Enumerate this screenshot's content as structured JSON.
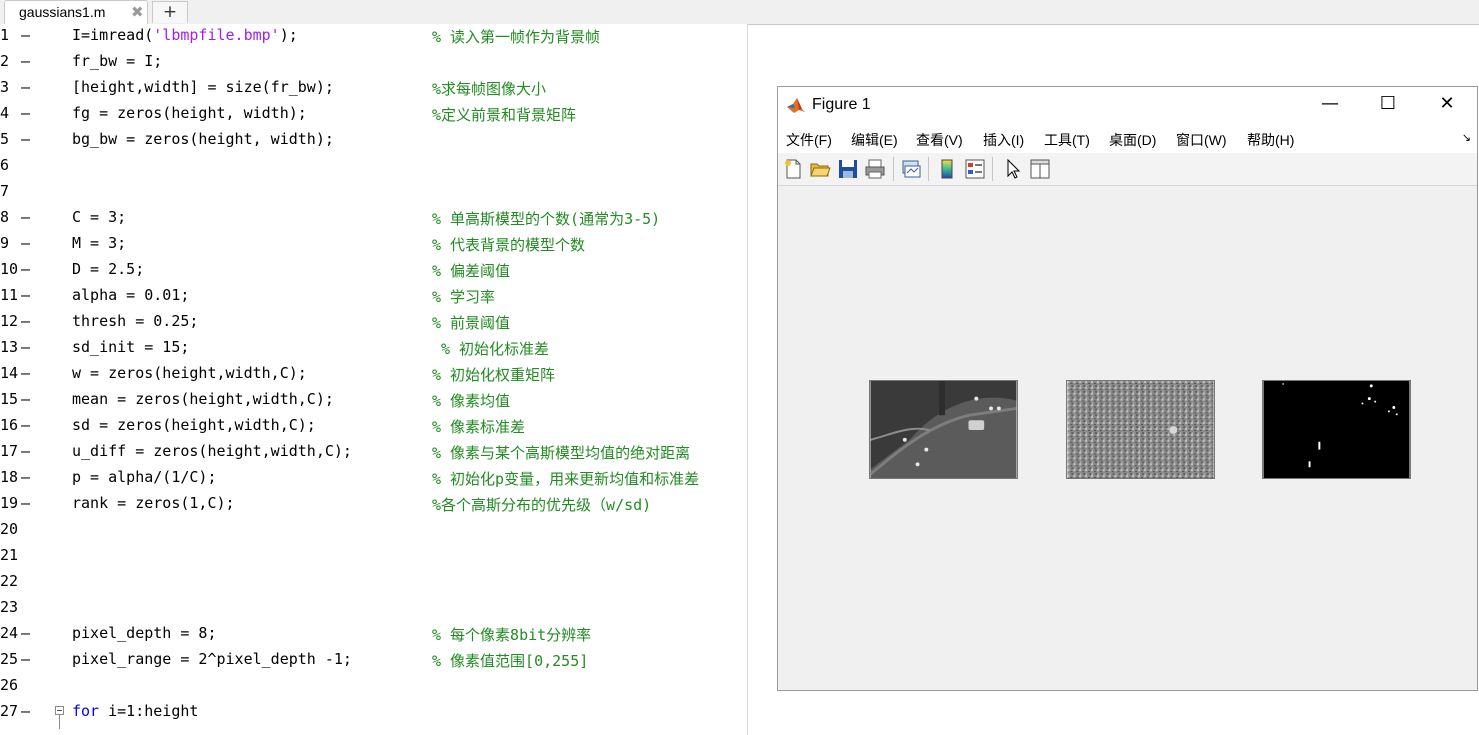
{
  "editor": {
    "tab_name": "gaussians1.m",
    "close_glyph": "✖",
    "new_tab_glyph": "+",
    "lines": [
      {
        "n": "1",
        "code": [
          {
            "t": "I=imread("
          },
          {
            "t": "'lbmpfile.bmp'",
            "c": "str"
          },
          {
            "t": ");"
          }
        ],
        "comment": "% 读入第一帧作为背景帧"
      },
      {
        "n": "2",
        "code": [
          {
            "t": "fr_bw = I;"
          }
        ],
        "comment": ""
      },
      {
        "n": "3",
        "code": [
          {
            "t": "[height,width] = size(fr_bw);"
          }
        ],
        "comment": "%求每帧图像大小"
      },
      {
        "n": "4",
        "code": [
          {
            "t": "fg = zeros(height, width);"
          }
        ],
        "comment": "%定义前景和背景矩阵"
      },
      {
        "n": "5",
        "code": [
          {
            "t": "bg_bw = zeros(height, width);"
          }
        ],
        "comment": ""
      },
      {
        "n": "6",
        "code": [],
        "comment": ""
      },
      {
        "n": "7",
        "code": [],
        "comment": ""
      },
      {
        "n": "8",
        "code": [
          {
            "t": "C = 3;"
          }
        ],
        "comment": "% 单高斯模型的个数(通常为3-5)"
      },
      {
        "n": "9",
        "code": [
          {
            "t": "M = 3;"
          }
        ],
        "comment": "% 代表背景的模型个数"
      },
      {
        "n": "10",
        "code": [
          {
            "t": "D = 2.5;"
          }
        ],
        "comment": "% 偏差阈值"
      },
      {
        "n": "11",
        "code": [
          {
            "t": "alpha = 0.01;"
          }
        ],
        "comment": "% 学习率"
      },
      {
        "n": "12",
        "code": [
          {
            "t": "thresh = 0.25;"
          }
        ],
        "comment": "% 前景阈值"
      },
      {
        "n": "13",
        "code": [
          {
            "t": "sd_init = 15;"
          }
        ],
        "comment": "% 初始化标准差",
        "shift": true
      },
      {
        "n": "14",
        "code": [
          {
            "t": "w = zeros(height,width,C);"
          }
        ],
        "comment": "% 初始化权重矩阵"
      },
      {
        "n": "15",
        "code": [
          {
            "t": "mean = zeros(height,width,C);"
          }
        ],
        "comment": "% 像素均值"
      },
      {
        "n": "16",
        "code": [
          {
            "t": "sd = zeros(height,width,C);"
          }
        ],
        "comment": "% 像素标准差"
      },
      {
        "n": "17",
        "code": [
          {
            "t": "u_diff = zeros(height,width,C);"
          }
        ],
        "comment": "% 像素与某个高斯模型均值的绝对距离"
      },
      {
        "n": "18",
        "code": [
          {
            "t": "p = alpha/(1/C);"
          }
        ],
        "comment": "% 初始化p变量，用来更新均值和标准差"
      },
      {
        "n": "19",
        "code": [
          {
            "t": "rank = zeros(1,C);"
          }
        ],
        "comment": "%各个高斯分布的优先级（w/sd)"
      },
      {
        "n": "20",
        "code": [],
        "comment": ""
      },
      {
        "n": "21",
        "code": [],
        "comment": ""
      },
      {
        "n": "22",
        "code": [],
        "comment": ""
      },
      {
        "n": "23",
        "code": [],
        "comment": ""
      },
      {
        "n": "24",
        "code": [
          {
            "t": "pixel_depth = 8;"
          }
        ],
        "comment": "% 每个像素8bit分辨率"
      },
      {
        "n": "25",
        "code": [
          {
            "t": "pixel_range = 2^pixel_depth -1;"
          }
        ],
        "comment": "% 像素值范围[0,255]"
      },
      {
        "n": "26",
        "code": [],
        "comment": ""
      },
      {
        "n": "27",
        "code": [
          {
            "t": "for",
            "c": "kw"
          },
          {
            "t": " i=1:height"
          }
        ],
        "comment": "",
        "fold": true
      }
    ]
  },
  "figure": {
    "title": "Figure 1",
    "controls": {
      "minimize": "—",
      "maximize": "☐",
      "close": "✕"
    },
    "menu": [
      "文件(F)",
      "编辑(E)",
      "查看(V)",
      "插入(I)",
      "工具(T)",
      "桌面(D)",
      "窗口(W)",
      "帮助(H)"
    ],
    "menu_corner_glyph": "↘",
    "toolbar": [
      "new-figure",
      "open-file",
      "save",
      "print",
      "link-plot",
      "colorbar",
      "insert-legend",
      "edit-plot",
      "property-inspector"
    ],
    "subplots": [
      {
        "name": "original-frame",
        "bg": "#5a5a5a"
      },
      {
        "name": "background-estimate",
        "bg": "#8a8a8a"
      },
      {
        "name": "foreground-mask",
        "bg": "#000000"
      }
    ]
  }
}
